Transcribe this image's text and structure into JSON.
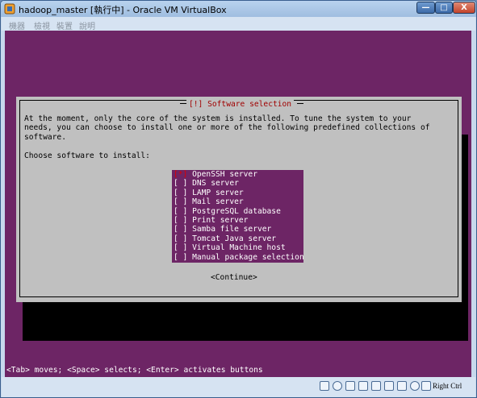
{
  "window": {
    "title": "hadoop_master [執行中] - Oracle VM VirtualBox"
  },
  "menu": [
    "機器",
    "檢視",
    "裝置",
    "說明"
  ],
  "dialog": {
    "title": "[!] Software selection",
    "intro": "At the moment, only the core of the system is installed. To tune the system to your\nneeds, you can choose to install one or more of the following predefined collections of\nsoftware.",
    "prompt": "Choose software to install:",
    "items": [
      {
        "checkbox": "[*]",
        "label": "OpenSSH server",
        "checked": true
      },
      {
        "checkbox": "[ ]",
        "label": "DNS server",
        "checked": false
      },
      {
        "checkbox": "[ ]",
        "label": "LAMP server",
        "checked": false
      },
      {
        "checkbox": "[ ]",
        "label": "Mail server",
        "checked": false
      },
      {
        "checkbox": "[ ]",
        "label": "PostgreSQL database",
        "checked": false
      },
      {
        "checkbox": "[ ]",
        "label": "Print server",
        "checked": false
      },
      {
        "checkbox": "[ ]",
        "label": "Samba file server",
        "checked": false
      },
      {
        "checkbox": "[ ]",
        "label": "Tomcat Java server",
        "checked": false
      },
      {
        "checkbox": "[ ]",
        "label": "Virtual Machine host",
        "checked": false
      },
      {
        "checkbox": "[ ]",
        "label": "Manual package selection",
        "checked": false
      }
    ],
    "continue_label": "<Continue>"
  },
  "help_line": "<Tab> moves; <Space> selects; <Enter> activates buttons",
  "statusbar": {
    "icons": [
      "hdd-icon",
      "cdrom-icon",
      "usb-icon",
      "network-icon",
      "shared-folder-icon",
      "display-icon",
      "capture-icon",
      "mouse-integration-icon",
      "keyboard-icon"
    ],
    "host_key": "Right Ctrl"
  },
  "colors": {
    "vm_background": "#6d2565",
    "dialog": "#c0c0c0",
    "dialog_title": "#a00000",
    "checked_mark": "#e00000"
  }
}
